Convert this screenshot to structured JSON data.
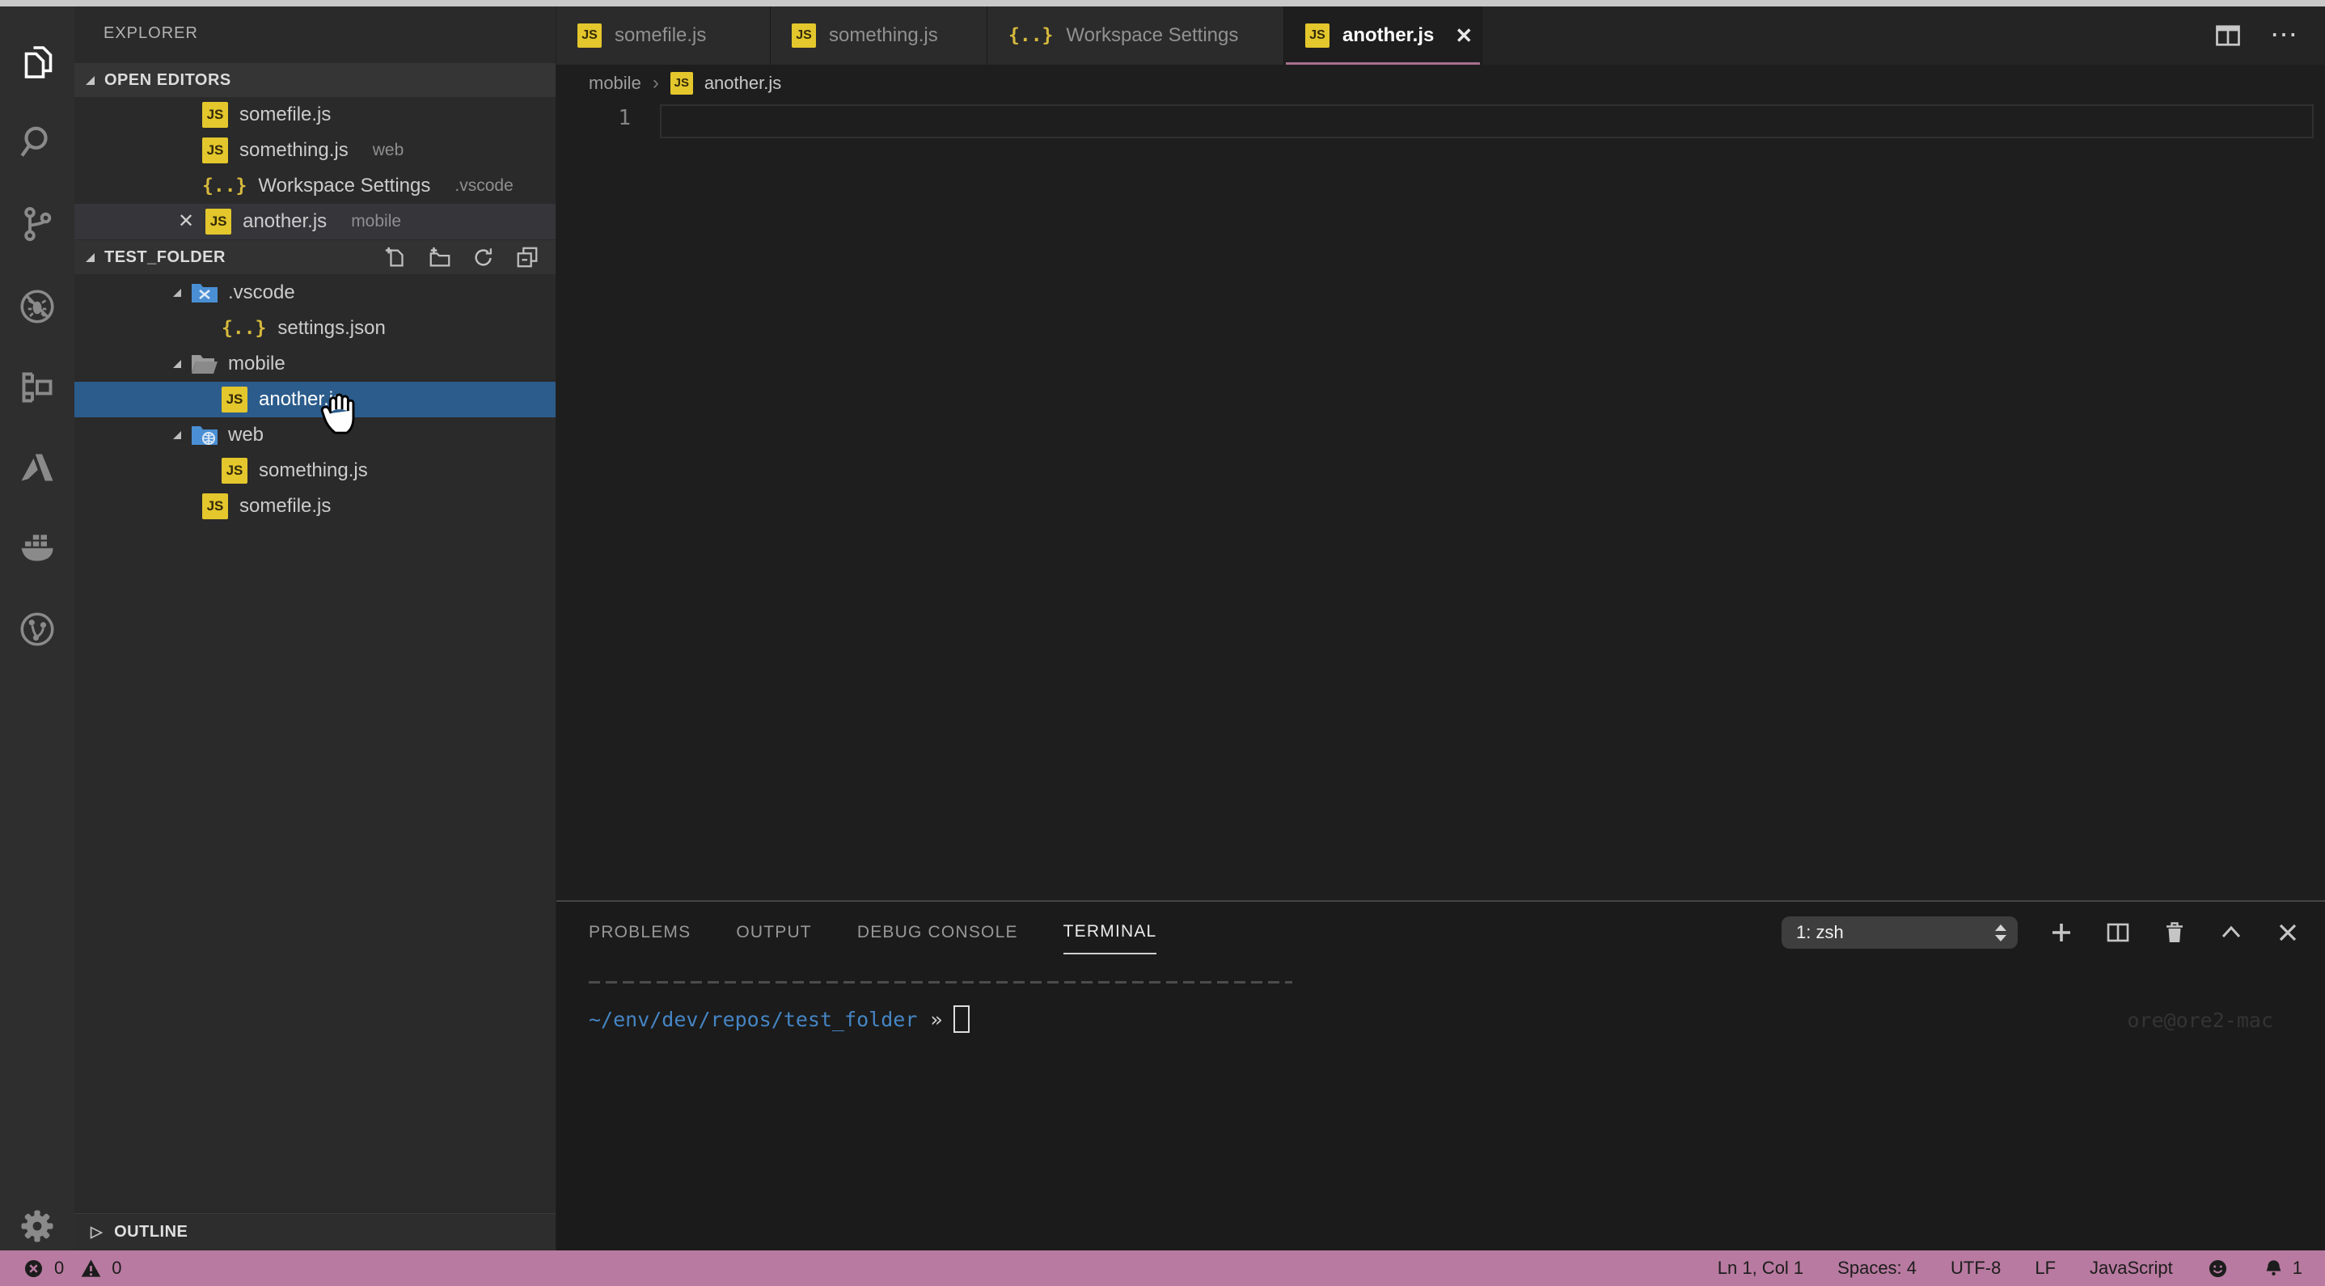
{
  "colors": {
    "selection_blue": "#2b5c8c",
    "status_bar_pink": "#b87aa0",
    "active_tab_underline": "#a8708e",
    "js_badge_yellow": "#e3c72c",
    "terminal_path_blue": "#4585c4"
  },
  "glyphs": {
    "close": "✕",
    "ellipsis": "⋯",
    "breadcrumb_sep": "›",
    "outline_chevron": "▷",
    "js_badge": "JS",
    "json_braces": "{..}"
  },
  "activity_bar": {
    "items": [
      "explorer",
      "search",
      "source-control",
      "debug",
      "extensions",
      "azure",
      "docker",
      "git-graph"
    ],
    "settings": "settings"
  },
  "sidebar": {
    "title": "EXPLORER",
    "open_editors": {
      "label": "OPEN EDITORS",
      "items": [
        {
          "name": "somefile.js",
          "detail": ""
        },
        {
          "name": "something.js",
          "detail": "web"
        },
        {
          "name": "Workspace Settings",
          "detail": ".vscode"
        },
        {
          "name": "another.js",
          "detail": "mobile"
        }
      ]
    },
    "section": {
      "label": "TEST_FOLDER",
      "actions": [
        "new-file",
        "new-folder",
        "refresh",
        "collapse-all"
      ],
      "tree": [
        {
          "name": ".vscode"
        },
        {
          "name": "settings.json"
        },
        {
          "name": "mobile"
        },
        {
          "name": "another.js"
        },
        {
          "name": "web"
        },
        {
          "name": "something.js"
        },
        {
          "name": "somefile.js"
        }
      ]
    },
    "outline_label": "OUTLINE"
  },
  "editor": {
    "tabs": [
      {
        "label": "somefile.js"
      },
      {
        "label": "something.js"
      },
      {
        "label": "Workspace Settings"
      },
      {
        "label": "another.js"
      }
    ],
    "breadcrumb": {
      "folder": "mobile",
      "file": "another.js"
    },
    "line_number": "1"
  },
  "panel": {
    "tabs": [
      {
        "label": "PROBLEMS"
      },
      {
        "label": "OUTPUT"
      },
      {
        "label": "DEBUG CONSOLE"
      },
      {
        "label": "TERMINAL"
      }
    ],
    "terminal_select": "1: zsh",
    "terminal": {
      "prompt_path": "~/env/dev/repos/test_folder",
      "prompt_symbol": "»",
      "watermark": "ore@ore2-mac"
    }
  },
  "status_bar": {
    "errors": "0",
    "warnings": "0",
    "cursor_position": "Ln 1, Col 1",
    "indentation": "Spaces: 4",
    "encoding": "UTF-8",
    "eol": "LF",
    "language": "JavaScript",
    "notification_count": "1"
  }
}
